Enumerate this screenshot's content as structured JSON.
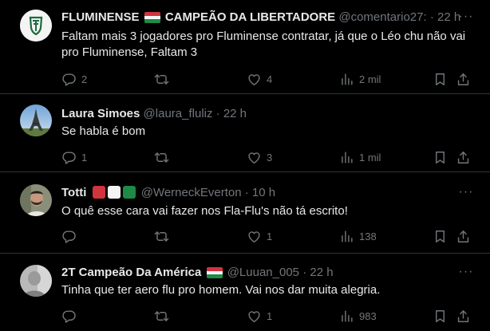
{
  "colors": {
    "background": "#000000",
    "text": "#e7e9ea",
    "muted": "#71767b",
    "divider": "#2f3336",
    "flag_red": "#d0343e",
    "flag_green": "#1e8a45",
    "flag_white": "#f4f4f4"
  },
  "tweets": [
    {
      "name": "FLUMINENSE",
      "name_emoji": "flag-hungary",
      "name_suffix": "CAMPEÃO DA LIBERTADORE",
      "handle": "@comentario27:",
      "dot": "·",
      "time": "22 h",
      "text": "Faltam mais 3 jogadores pro Fluminense contratar, já que o Léo chu não vai pro Fluminense, Faltam 3",
      "avatar": "fluminense-crest",
      "replies": "2",
      "retweets": "",
      "likes": "4",
      "views": "2 mil"
    },
    {
      "name": "Laura Simoes",
      "handle": "@laura_fluliz",
      "dot": "·",
      "time": "22 h",
      "text": "Se habla é bom",
      "avatar": "eiffel-tower-photo",
      "replies": "1",
      "retweets": "",
      "likes": "3",
      "views": "1 mil"
    },
    {
      "name": "Totti",
      "name_emoji": "red-white-green-squares",
      "handle": "@WerneckEverton",
      "dot": "·",
      "time": "10 h",
      "text": "O quê esse cara vai fazer nos Fla-Flu's não tá escrito!",
      "avatar": "man-with-beard-photo",
      "replies": "",
      "retweets": "",
      "likes": "1",
      "views": "138"
    },
    {
      "name": "2T Campeão Da América",
      "name_emoji": "flag-hungary",
      "handle": "@Luuan_005",
      "dot": "·",
      "time": "22 h",
      "text": "Tinha que ter aero flu pro homem. Vai nos dar muita alegria.",
      "avatar": "grayscale-person-photo",
      "replies": "",
      "retweets": "",
      "likes": "1",
      "views": "983"
    }
  ]
}
